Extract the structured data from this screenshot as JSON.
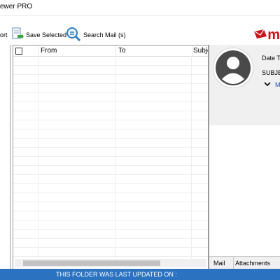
{
  "window": {
    "title": "ewer PRO"
  },
  "toolbar": {
    "export_label": "ort",
    "save_selected_label": "Save Selected",
    "search_mail_label": "Search Mail (s)",
    "brand_text": "m"
  },
  "grid": {
    "columns": [
      "From",
      "To",
      "Subje"
    ]
  },
  "preview": {
    "date_label": "Date Ti",
    "subject_label": "SUBJE",
    "more_label": "M"
  },
  "tabs": {
    "mail": "Mail",
    "attachments": "Attachments"
  },
  "status": {
    "text": "THIS FOLDER WAS LAST UPDATED ON :"
  },
  "colors": {
    "brand": "#c8161d",
    "status_bar": "#2b72c0",
    "preview_bg": "#f0f0f0"
  },
  "icons": {
    "save": "save-selected-icon",
    "search": "search-mail-icon",
    "expand": "chevron-down-icon",
    "avatar": "user-avatar-icon",
    "brand": "envelope-logo-icon"
  }
}
